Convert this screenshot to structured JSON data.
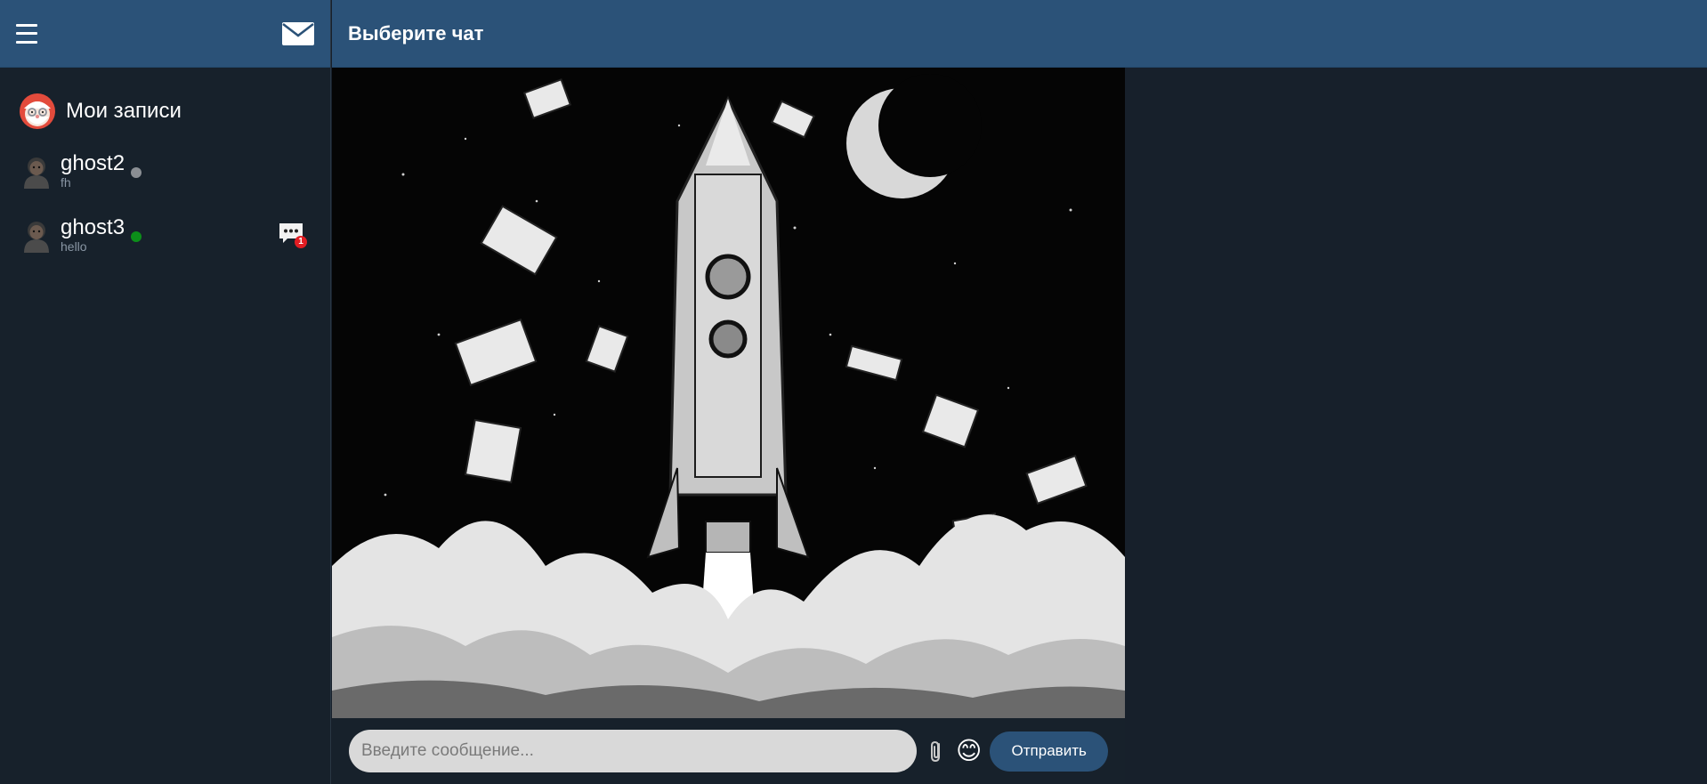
{
  "sidebar": {
    "menu_icon": "hamburger-menu-icon",
    "mail_icon": "envelope-icon",
    "saved": {
      "name": "Мои записи",
      "avatar_icon": "santa-avatar-icon"
    },
    "chats": [
      {
        "name": "ghost2",
        "preview": "fh",
        "status": "offline",
        "avatar_icon": "person-avatar-icon"
      },
      {
        "name": "ghost3",
        "preview": "hello",
        "status": "online",
        "avatar_icon": "person-avatar-icon",
        "unread_count": "1",
        "unread_icon": "chat-bubble-icon"
      }
    ]
  },
  "main": {
    "title": "Выберите чат",
    "background_image": "rocket-launch-illustration"
  },
  "composer": {
    "placeholder": "Введите сообщение...",
    "attach_icon": "paperclip-icon",
    "emoji": "😊",
    "send_label": "Отправить"
  },
  "colors": {
    "header": "#2b5278",
    "sidebar_bg": "#17212b",
    "online": "#0c8f1a",
    "offline": "#8b8f94",
    "badge": "#e21d23"
  }
}
